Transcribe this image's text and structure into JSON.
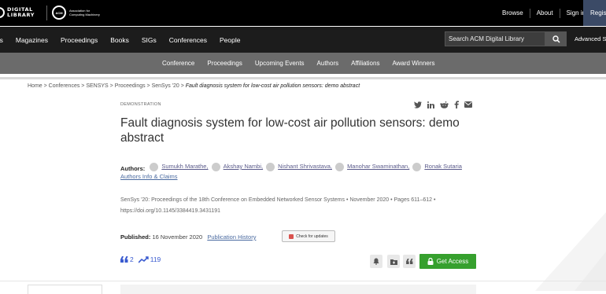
{
  "header": {
    "dl_logo_line1": "DIGITAL",
    "dl_logo_line2": "LIBRARY",
    "acm_badge": "ACM",
    "acm_line1": "Association for",
    "acm_line2": "Computing Machinery",
    "links": [
      "Browse",
      "About",
      "Sign in"
    ],
    "register_label": "Regist"
  },
  "mainnav": {
    "items": [
      "als",
      "Magazines",
      "Proceedings",
      "Books",
      "SIGs",
      "Conferences",
      "People"
    ],
    "search_placeholder": "Search ACM Digital Library",
    "advanced_label": "Advanced Se"
  },
  "subnav": {
    "items": [
      "Conference",
      "Proceedings",
      "Upcoming Events",
      "Authors",
      "Affiliations",
      "Award Winners"
    ]
  },
  "breadcrumb": {
    "trail": "Home > Conferences > SENSYS > Proceedings > SenSys '20 >",
    "current": "Fault diagnosis system for low-cost air pollution sensors: demo abstract"
  },
  "article": {
    "type_label": "DEMONSTRATION",
    "title": "Fault diagnosis system for low-cost air pollution sensors: demo abstract",
    "authors_label": "Authors:",
    "authors": [
      "Sumukh Marathe,",
      "Akshay Nambi,",
      "Nishant Shrivastava,",
      "Manohar Swaminathan,",
      "Ronak Sutaria"
    ],
    "authors_info": "Authors Info & Claims",
    "pub_info": "SenSys '20: Proceedings of the 18th Conference on Embedded Networked Sensor Systems • November 2020 • Pages 611–612 • https://doi.org/10.1145/3384419.3431191",
    "published_label": "Published:",
    "published_date": "16 November 2020",
    "history_link": "Publication History",
    "check_updates": "Check for updates",
    "citations": "2",
    "downloads": "119",
    "get_access": "Get Access"
  },
  "icons": [
    "twitter-icon",
    "linkedin-icon",
    "reddit-icon",
    "facebook-icon",
    "email-icon",
    "search-icon",
    "quote-icon",
    "trend-icon",
    "bell-icon",
    "folder-icon",
    "lock-icon"
  ],
  "colors": {
    "topbar": "#000000",
    "nav": "#1c1c1c",
    "subnav": "#6b6b6b",
    "accent_green": "#36a02e",
    "link_blue": "#4a6aa0"
  }
}
